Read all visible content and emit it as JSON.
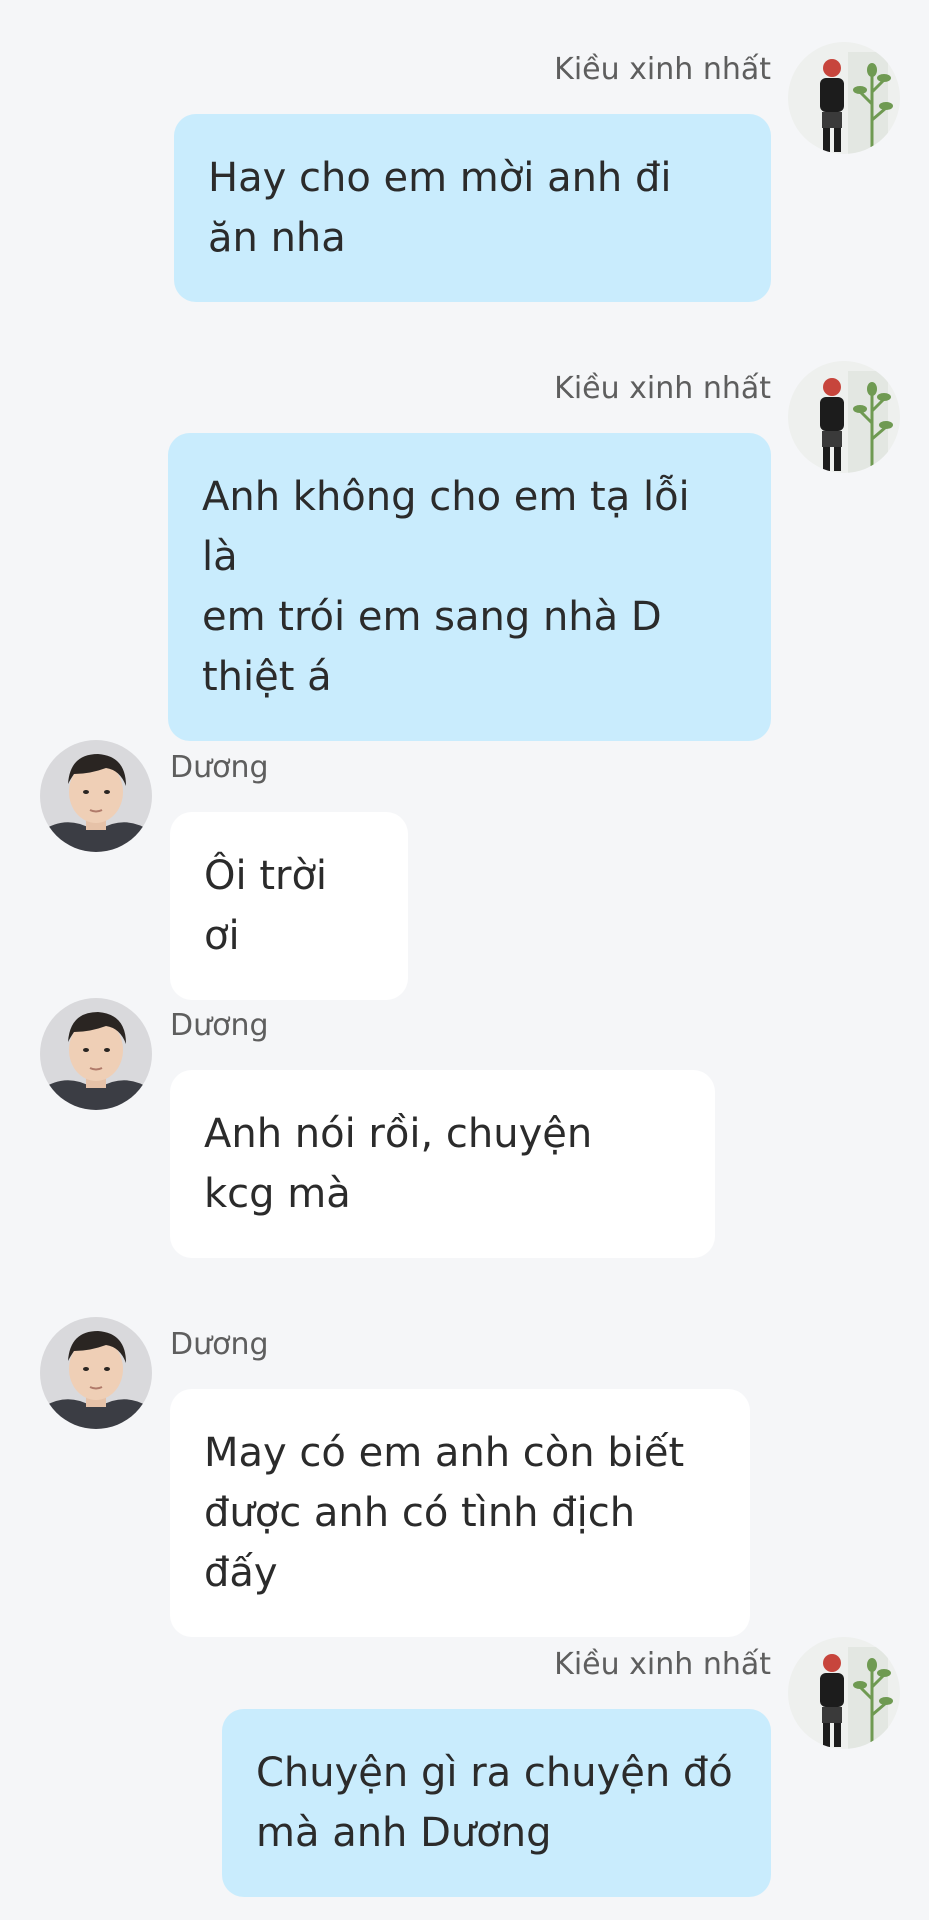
{
  "messages": [
    {
      "direction": "out",
      "sender": "Kiều xinh nhất",
      "text": "Hay cho em mời anh đi\năn nha"
    },
    {
      "direction": "out",
      "sender": "Kiều xinh nhất",
      "text": "Anh không cho em tạ lỗi là\nem trói em sang nhà D\nthiệt á"
    },
    {
      "direction": "in",
      "sender": "Dương",
      "text": "Ôi trời ơi"
    },
    {
      "direction": "in",
      "sender": "Dương",
      "text": "Anh nói rồi, chuyện\nkcg mà"
    },
    {
      "direction": "in",
      "sender": "Dương",
      "text": "May có em anh còn biết\nđược anh có tình địch đấy"
    },
    {
      "direction": "out",
      "sender": "Kiều xinh nhất",
      "text": "Chuyện gì ra chuyện đó\nmà anh Dương"
    }
  ],
  "colors": {
    "background": "#f5f6f8",
    "outgoing_bubble": "#c9ecfd",
    "incoming_bubble": "#ffffff",
    "sender_text": "#5e5e5e",
    "message_text": "#2b2b2b"
  },
  "avatars": {
    "out": "avatar-kieu-icon",
    "in": "avatar-duong-icon"
  }
}
